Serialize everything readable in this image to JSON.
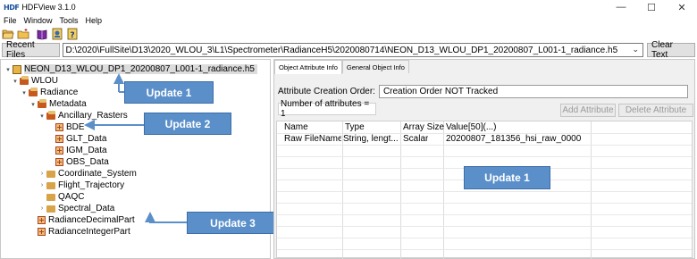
{
  "window": {
    "logo": "HDF",
    "title": "HDFView 3.1.0",
    "minimize": "—",
    "maximize": "☐",
    "close": "✕"
  },
  "menu": [
    "File",
    "Window",
    "Tools",
    "Help"
  ],
  "toolbar": {
    "icons": [
      "open-folder-icon",
      "new-folder-icon",
      "book-icon",
      "user-guide-icon",
      "help-icon"
    ]
  },
  "recent": {
    "label": "Recent Files",
    "path": "D:\\2020\\FullSite\\D13\\2020_WLOU_3\\L1\\Spectrometer\\RadianceH5\\2020080714\\NEON_D13_WLOU_DP1_20200807_L001-1_radiance.h5",
    "dropdown_arrow": "⌄",
    "clear_label": "Clear Text"
  },
  "tree": {
    "root": "NEON_D13_WLOU_DP1_20200807_L001-1_radiance.h5",
    "wlou": "WLOU",
    "radiance": "Radiance",
    "metadata": "Metadata",
    "ancillary": "Ancillary_Rasters",
    "bde": "BDE",
    "glt": "GLT_Data",
    "igm": "IGM_Data",
    "obs": "OBS_Data",
    "coord": "Coordinate_System",
    "flight": "Flight_Trajectory",
    "qaqc": "QAQC",
    "spectral": "Spectral_Data",
    "decimal": "RadianceDecimalPart",
    "integer": "RadianceIntegerPart"
  },
  "callouts": {
    "update1_left": "Update 1",
    "update2": "Update 2",
    "update3": "Update 3",
    "update1_right": "Update 1",
    "color": "#5b8fc9"
  },
  "tabs": [
    "Object Attribute Info",
    "General Object Info"
  ],
  "attr": {
    "creation_label": "Attribute Creation Order:",
    "creation_value": "Creation Order NOT Tracked",
    "count": "Number of attributes = 1",
    "add_label": "Add Attribute",
    "delete_label": "Delete Attribute"
  },
  "table": {
    "headers": [
      "Name",
      "Type",
      "Array Size",
      "Value[50](...)"
    ],
    "rows": [
      [
        "Raw FileName",
        "String, lengt...",
        "Scalar",
        "20200807_181356_hsi_raw_0000"
      ]
    ]
  }
}
